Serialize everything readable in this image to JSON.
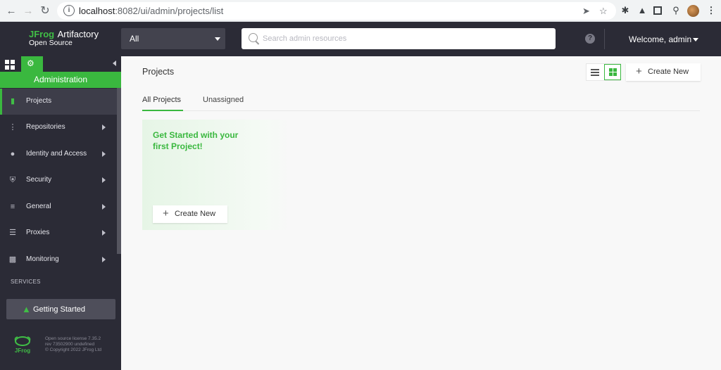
{
  "browser": {
    "url_host": "localhost",
    "url_rest": ":8082/ui/admin/projects/list"
  },
  "header": {
    "logo_brand": "JFrog",
    "logo_product": "Artifactory",
    "logo_edition": "Open Source",
    "repo_select_value": "All",
    "search_placeholder": "Search admin resources",
    "help_icon": "?",
    "welcome_text": "Welcome, admin"
  },
  "sidebar": {
    "banner": "Administration",
    "items": [
      {
        "label": "Projects",
        "icon": "projects-icon",
        "active": true
      },
      {
        "label": "Repositories",
        "icon": "repositories-icon"
      },
      {
        "label": "Identity and Access",
        "icon": "user-icon"
      },
      {
        "label": "Security",
        "icon": "shield-icon"
      },
      {
        "label": "General",
        "icon": "sliders-icon"
      },
      {
        "label": "Proxies",
        "icon": "server-icon"
      },
      {
        "label": "Monitoring",
        "icon": "bar-chart-icon"
      }
    ],
    "services_label": "SERVICES",
    "getting_started": "Getting Started",
    "footer_line1": "Open source license 7.35.2",
    "footer_line2": "rev 73502900 undefined",
    "footer_line3": "© Copyright 2022 JFrog Ltd"
  },
  "main": {
    "title": "Projects",
    "create_new": "Create New",
    "tabs": [
      {
        "label": "All Projects",
        "active": true
      },
      {
        "label": "Unassigned"
      }
    ],
    "card_title": "Get Started with your first Project!",
    "card_button": "Create New"
  },
  "colors": {
    "brand_green": "#40be46",
    "sidebar_bg": "#2b2b36"
  }
}
